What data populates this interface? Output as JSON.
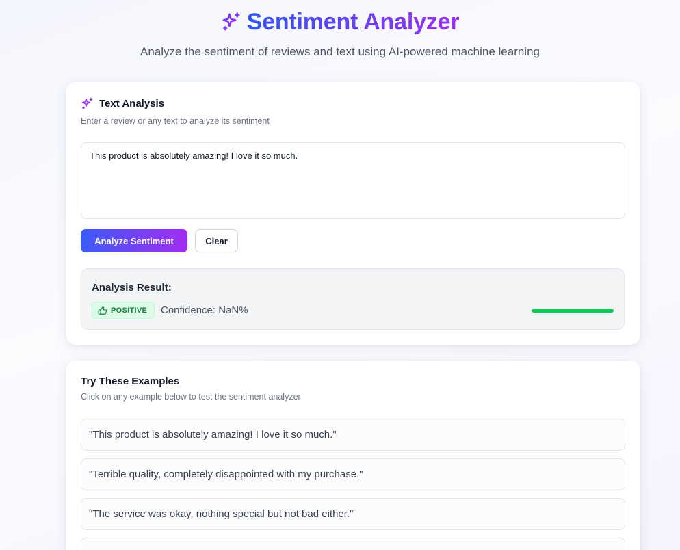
{
  "header": {
    "title": "Sentiment Analyzer",
    "subtitle": "Analyze the sentiment of reviews and text using AI-powered machine learning",
    "icon": "sparkles-icon"
  },
  "analysis_card": {
    "title": "Text Analysis",
    "icon": "sparkles-icon",
    "description": "Enter a review or any text to analyze its sentiment",
    "input_value": "This product is absolutely amazing! I love it so much.",
    "analyze_button": "Analyze Sentiment",
    "clear_button": "Clear",
    "result": {
      "heading": "Analysis Result:",
      "sentiment_label": "POSITIVE",
      "sentiment_icon": "thumbs-up-icon",
      "confidence_text": "Confidence: NaN%",
      "confidence_bar_fill": 1.0
    }
  },
  "examples_card": {
    "title": "Try These Examples",
    "description": "Click on any example below to test the sentiment analyzer",
    "items": [
      "\"This product is absolutely amazing! I love it so much.\"",
      "\"Terrible quality, completely disappointed with my purchase.\"",
      "\"The service was okay, nothing special but not bad either.\"",
      ""
    ]
  },
  "colors": {
    "accent_start": "#2f55f0",
    "accent_end": "#9b2cf0",
    "positive_bg": "#dcfce7",
    "positive_text": "#15803d",
    "bar_fill": "#16c75a"
  }
}
